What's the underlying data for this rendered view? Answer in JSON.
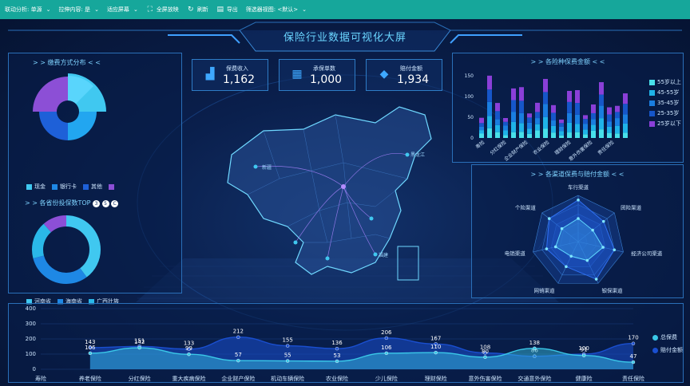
{
  "toolbar": {
    "items": [
      {
        "label": "联动分析: 单源",
        "name": "toolbar-linkage-select"
      },
      {
        "label": "拉伸内容: 是",
        "name": "toolbar-stretch-select"
      },
      {
        "label": "适应屏幕",
        "name": "toolbar-fit-select"
      },
      {
        "label": "全屏放映",
        "name": "toolbar-fullscreen-button",
        "icon": "fullscreen-icon"
      },
      {
        "label": "刷新",
        "name": "toolbar-refresh-button",
        "icon": "refresh-icon"
      },
      {
        "label": "导出",
        "name": "toolbar-export-button",
        "icon": "export-icon"
      },
      {
        "label": "筛选器视图: <默认>",
        "name": "toolbar-filter-view-select"
      }
    ]
  },
  "title": "保险行业数据可视化大屏",
  "kpis": [
    {
      "label": "保费收入",
      "value": "1,162"
    },
    {
      "label": "承保单数",
      "value": "1,000"
    },
    {
      "label": "赔付金额",
      "value": "1,934"
    }
  ],
  "payment": {
    "title": "> > 缴费方式分布 < <",
    "legend": [
      "现金",
      "银行卡",
      "其他"
    ],
    "colors": [
      "#40c8f0",
      "#1e88e5",
      "#8c4fd6"
    ]
  },
  "province": {
    "title": "> > 各省份投保数TOP",
    "legend": [
      "河南省",
      "海南省",
      "广西壮族"
    ]
  },
  "age_chart": {
    "title": "> > 各险种保费金额 < <",
    "categories": [
      "寿险",
      "分红保险",
      "企业财产保险",
      "农业保险",
      "理财保险",
      "意外伤害保险",
      "责任保险"
    ],
    "legend": [
      "55岁以上",
      "45-55岁",
      "35-45岁",
      "25-35岁",
      "25岁以下"
    ],
    "colors": [
      "#48e0ea",
      "#1fb3e8",
      "#1a7ee0",
      "#1656c9",
      "#8a3fd8"
    ],
    "yticks": [
      "0",
      "50",
      "100",
      "150"
    ]
  },
  "channel_radar": {
    "title": "> > 各渠道保费与赔付金额 < <",
    "axes": [
      "车行渠道",
      "团险渠道",
      "经济公司渠道",
      "银保渠道",
      "网销渠道",
      "电销渠道",
      "个险渠道"
    ]
  },
  "map_labels": [
    "新疆",
    "黑龙江",
    "福建"
  ],
  "chart_data": {
    "type": "area",
    "categories": [
      "寿险",
      "养老保险",
      "分红保险",
      "重大疾病保险",
      "企业财产保险",
      "机动车辆保险",
      "农业保险",
      "少儿保险",
      "理财保险",
      "意外伤害保险",
      "交通意外保险",
      "健康险",
      "责任保险"
    ],
    "series": [
      {
        "name": "总保费",
        "values": [
          null,
          106,
          142,
          99,
          57,
          55,
          53,
          106,
          110,
          80,
          138,
          91,
          47
        ]
      },
      {
        "name": "赔付金额",
        "values": [
          null,
          143,
          151,
          133,
          212,
          155,
          136,
          206,
          167,
          108,
          86,
          100,
          170
        ]
      }
    ],
    "ylim": [
      0,
      400
    ],
    "yticks": [
      "0",
      "100",
      "200",
      "300",
      "400"
    ],
    "colors": [
      "#3ac8e8",
      "#1a4fd0"
    ]
  }
}
